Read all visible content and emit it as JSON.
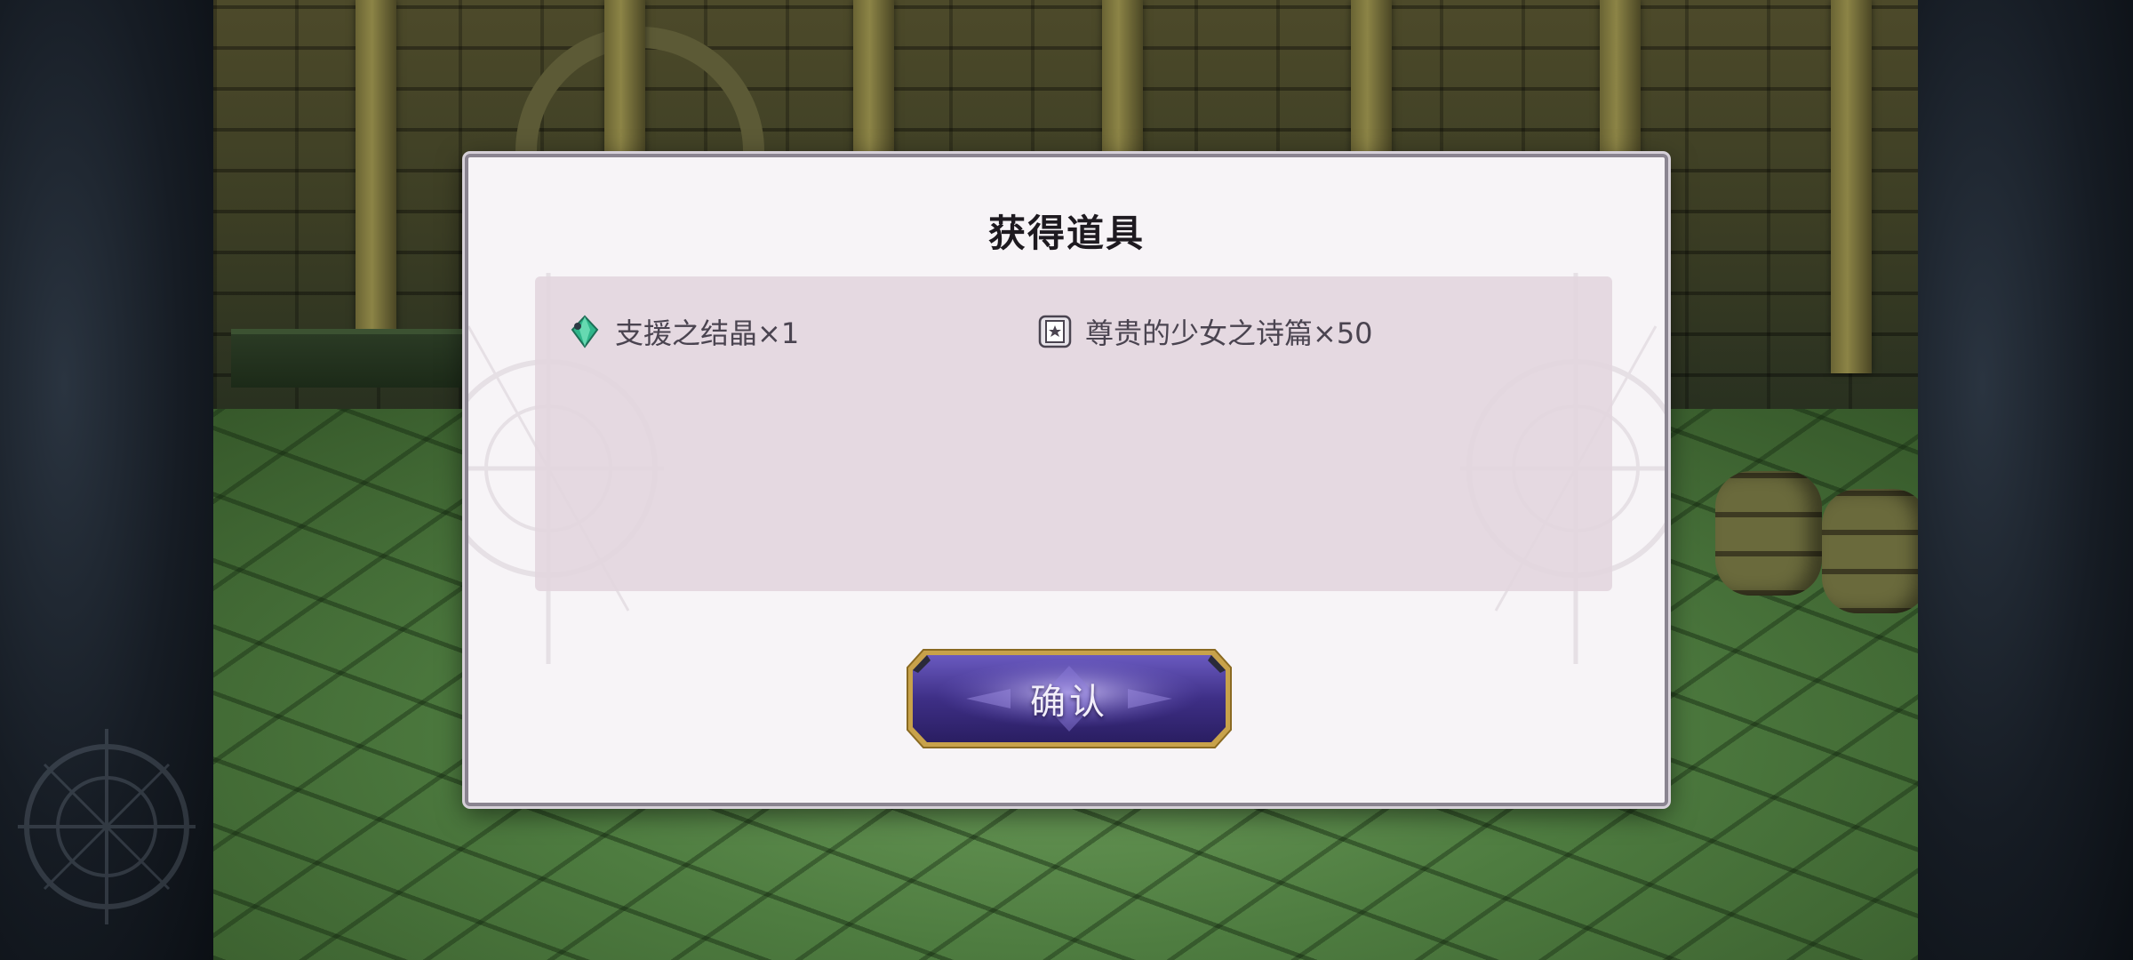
{
  "dialog": {
    "title": "获得道具",
    "items": [
      {
        "icon": "green-crystal-icon",
        "label": "支援之结晶×1"
      },
      {
        "icon": "poem-book-icon",
        "label": "尊贵的少女之诗篇×50"
      }
    ],
    "confirm_label": "确认"
  },
  "colors": {
    "dialog_background": "#f7f4f7",
    "item_panel": "#e2d6de",
    "button_fill": "#4a3c8c",
    "button_border": "#c8a24a"
  }
}
